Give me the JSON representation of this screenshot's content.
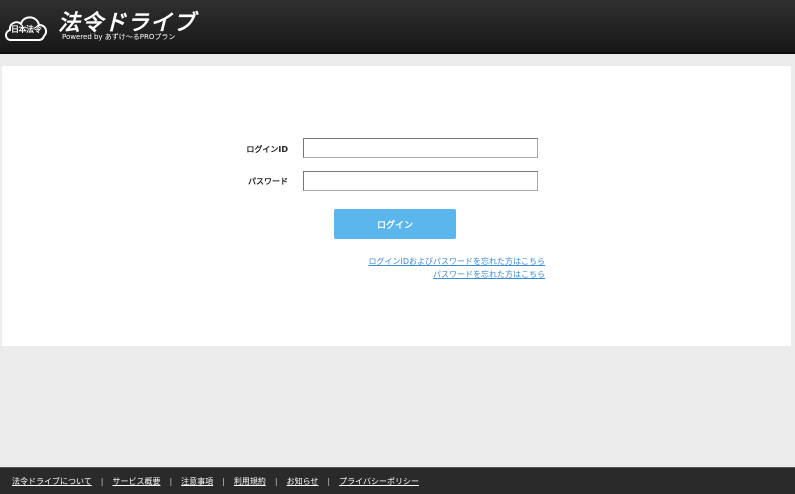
{
  "header": {
    "badge": "日本法令",
    "title": "法令ドライブ",
    "subtitle": "Powered by あずけ～るPROプラン"
  },
  "form": {
    "login_id_label": "ログインID",
    "password_label": "パスワード",
    "login_id_value": "",
    "password_value": "",
    "login_button": "ログイン",
    "forgot_both_link": "ログインIDおよびパスワードを忘れた方はこちら",
    "forgot_password_link": "パスワードを忘れた方はこちら"
  },
  "footer": {
    "links": [
      "法令ドライブについて",
      "サービス概要",
      "注意事項",
      "利用規約",
      "お知らせ",
      "プライバシーポリシー"
    ],
    "separator": "|"
  },
  "colors": {
    "header_bg": "#1f1f1f",
    "button": "#5bb6ee",
    "link": "#3a8ad8",
    "page_bg": "#ebebeb"
  }
}
